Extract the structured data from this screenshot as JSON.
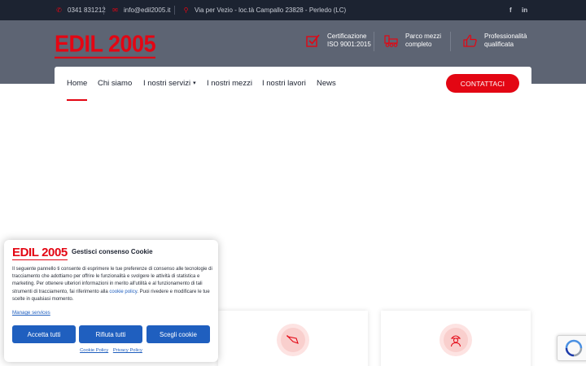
{
  "topbar": {
    "phone": "0341 831212",
    "email": "info@edil2005.it",
    "address": "Via per Vezio - loc.tà Campallo 23828 - Perledo (LC)",
    "social": [
      "f",
      "in"
    ]
  },
  "header": {
    "logo_text": "EDIL 2005",
    "features": [
      {
        "line1": "Certificazione",
        "line2": "ISO 9001:2015",
        "icon": "checkbox-icon"
      },
      {
        "line1": "Parco mezzi",
        "line2": "completo",
        "icon": "truck-icon"
      },
      {
        "line1": "Professionalità",
        "line2": "qualificata",
        "icon": "thumbs-up-icon"
      }
    ]
  },
  "nav": {
    "items": [
      "Home",
      "Chi siamo",
      "I nostri servizi",
      "I nostri mezzi",
      "I nostri lavori",
      "News"
    ],
    "cta": "CONTATTACI"
  },
  "cookie": {
    "logo_text": "EDIL 2005",
    "title": "Gestisci consenso Cookie",
    "body_pre": "Il seguente pannello ti consente di esprimere le tue preferenze di consenso alle tecnologie di tracciamento che adottiamo per offrire le funzionalità e svolgere le attività di statistica e marketing. Per ottenere ulteriori informazioni in merito all'utilità e al funzionamento di tali strumenti di tracciamento, fai riferimento alla ",
    "body_link": "cookie policy",
    "body_post": ". Puoi rivedere e modificare le tue scelte in qualsiasi momento.",
    "manage": "Manage services",
    "accept": "Accetta tutti",
    "reject": "Rifiuta tutti",
    "choose": "Scegli cookie",
    "cookie_policy": "Cookie Policy",
    "privacy_policy": "Privacy Policy"
  },
  "colors": {
    "brand_red": "#e30613",
    "topbar_bg": "#1c2331",
    "header_bg": "#5d6473",
    "cookie_blue": "#1f5fbf"
  }
}
